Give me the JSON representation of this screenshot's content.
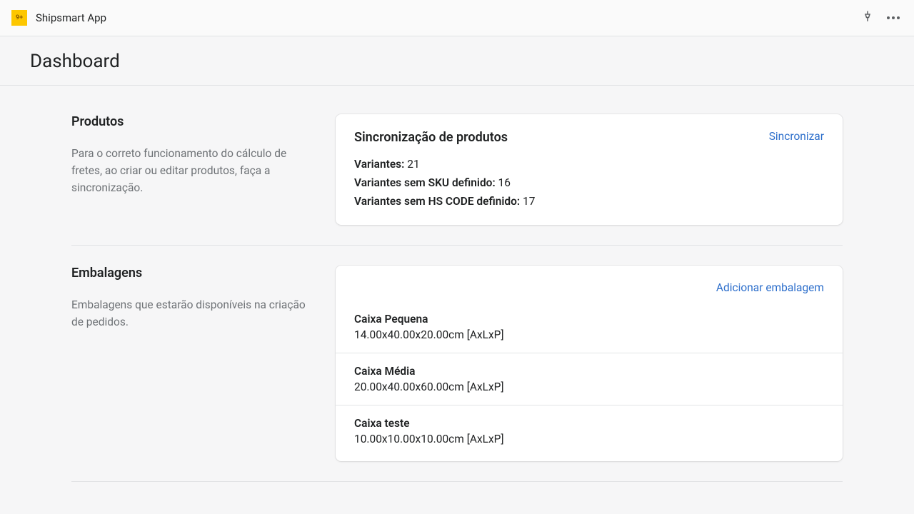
{
  "header": {
    "app_title": "Shipsmart App"
  },
  "page": {
    "title": "Dashboard"
  },
  "products_section": {
    "heading": "Produtos",
    "description": "Para o correto funcionamento do cálculo de fretes, ao criar ou editar produtos, faça a sincronização.",
    "card": {
      "title": "Sincronização de produtos",
      "action": "Sincronizar",
      "stats": {
        "variants_label": "Variantes:",
        "variants_value": "21",
        "no_sku_label": "Variantes sem SKU definido:",
        "no_sku_value": "16",
        "no_hs_label": "Variantes sem HS CODE definido:",
        "no_hs_value": "17"
      }
    }
  },
  "packaging_section": {
    "heading": "Embalagens",
    "description": "Embalagens que estarão disponíveis na criação de pedidos.",
    "action": "Adicionar embalagem",
    "items": [
      {
        "name": "Caixa Pequena",
        "dims": "14.00x40.00x20.00cm [AxLxP]"
      },
      {
        "name": "Caixa Média",
        "dims": "20.00x40.00x60.00cm [AxLxP]"
      },
      {
        "name": "Caixa teste",
        "dims": "10.00x10.00x10.00cm [AxLxP]"
      }
    ]
  }
}
